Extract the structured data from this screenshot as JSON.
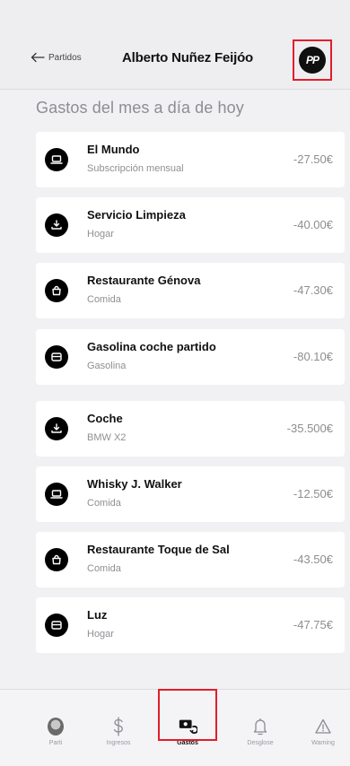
{
  "header": {
    "back_label": "Partidos",
    "title": "Alberto Nuñez Feijóo",
    "party_logo_text": "PP"
  },
  "section_title": "Gastos del mes a día de hoy",
  "expenses": [
    {
      "name": "El Mundo",
      "category": "Subscripción mensual",
      "amount": "-27.50€",
      "icon": "laptop-icon"
    },
    {
      "name": "Servicio Limpieza",
      "category": "Hogar",
      "amount": "-40.00€",
      "icon": "download-icon"
    },
    {
      "name": "Restaurante Génova",
      "category": "Comida",
      "amount": "-47.30€",
      "icon": "shopping-bag-icon"
    },
    {
      "name": "Gasolina coche partido",
      "category": "Gasolina",
      "amount": "-80.10€",
      "icon": "credit-card-icon"
    },
    {
      "name": "Coche",
      "category": "BMW X2",
      "amount": "-35.500€",
      "icon": "download-icon"
    },
    {
      "name": "Whisky J. Walker",
      "category": "Comida",
      "amount": "-12.50€",
      "icon": "laptop-icon"
    },
    {
      "name": "Restaurante Toque de Sal",
      "category": "Comida",
      "amount": "-43.50€",
      "icon": "shopping-bag-icon"
    },
    {
      "name": "Luz",
      "category": "Hogar",
      "amount": "-47.75€",
      "icon": "credit-card-icon"
    }
  ],
  "tabbar": {
    "tabs": [
      {
        "label": "Parti",
        "icon": "avatar-icon"
      },
      {
        "label": "Ingresos",
        "icon": "dollar-icon"
      },
      {
        "label": "Gastos",
        "icon": "money-exchange-icon",
        "active": true
      },
      {
        "label": "Desglose",
        "icon": "bell-icon"
      },
      {
        "label": "Warning",
        "icon": "warning-icon"
      }
    ]
  },
  "colors": {
    "highlight": "#e21d2a",
    "background": "#f1f1f3",
    "card": "#ffffff",
    "icon_bg": "#000000",
    "muted_text": "#8d8d93"
  }
}
